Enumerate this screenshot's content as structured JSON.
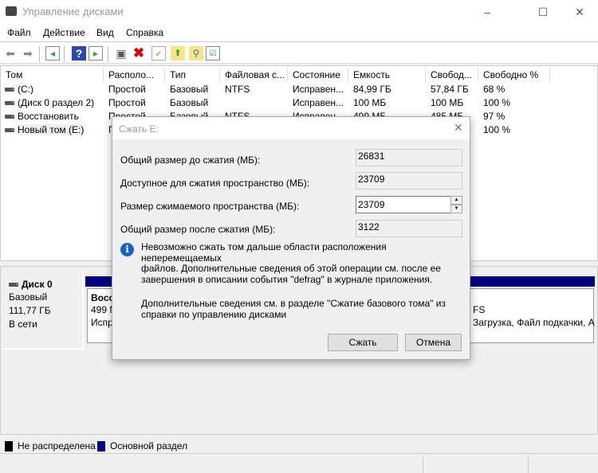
{
  "window": {
    "title": "Управление дисками",
    "icon": "disk-management-icon"
  },
  "menu": [
    "Файл",
    "Действие",
    "Вид",
    "Справка"
  ],
  "toolbar": [
    "back-icon",
    "forward-icon",
    "console-tree-icon",
    "help-icon",
    "action-pane-icon",
    "connect-disk-icon",
    "delete-icon",
    "properties-icon",
    "folder-up-icon",
    "folder-search-icon",
    "checklist-icon"
  ],
  "table": {
    "columns": [
      "Том",
      "Располо...",
      "Тип",
      "Файловая с...",
      "Состояние",
      "Емкость",
      "Свобод...",
      "Свободно %"
    ],
    "rows": [
      [
        "(C:)",
        "Простой",
        "Базовый",
        "NTFS",
        "Исправен...",
        "84,99 ГБ",
        "57,84 ГБ",
        "68 %"
      ],
      [
        "(Диск 0 раздел 2)",
        "Простой",
        "Базовый",
        "",
        "Исправен...",
        "100 МБ",
        "100 МБ",
        "100 %"
      ],
      [
        "Восстановить",
        "Простой",
        "Базовый",
        "NTFS",
        "Исправен...",
        "499 МБ",
        "485 МБ",
        "97 %"
      ],
      [
        "Новый том (E:)",
        "П",
        "",
        "",
        "",
        "",
        "",
        "100 %"
      ]
    ]
  },
  "disk": {
    "name": "Диск 0",
    "type": "Базовый",
    "size": "111,77 ГБ",
    "status": "В сети",
    "part_left": [
      "Восс",
      "499 М",
      "Испр"
    ],
    "part_right": [
      "FS",
      "Загрузка, Файл подкачки, А"
    ]
  },
  "legend": [
    {
      "label": "Не распределена",
      "color": "#000000"
    },
    {
      "label": "Основной раздел",
      "color": "#000080"
    }
  ],
  "dialog": {
    "title": "Сжать E:",
    "fields": [
      {
        "label": "Общий размер до сжатия (МБ):",
        "value": "26831"
      },
      {
        "label": "Доступное для сжатия пространство (МБ):",
        "value": "23709"
      },
      {
        "label": "Размер сжимаемого пространства (МБ):",
        "value": "23709"
      },
      {
        "label": "Общий размер после сжатия (МБ):",
        "value": "3122"
      }
    ],
    "info": [
      "Невозможно сжать том дальше области расположения неперемещаемых",
      "файлов. Дополнительные сведения об этой операции см. после ее",
      "завершения в описании события \"defrag\" в журнале приложения."
    ],
    "help": [
      "Дополнительные сведения см. в разделе \"Сжатие базового тома\" из",
      "справки по управлению дисками"
    ],
    "ok": "Сжать",
    "cancel": "Отмена"
  }
}
